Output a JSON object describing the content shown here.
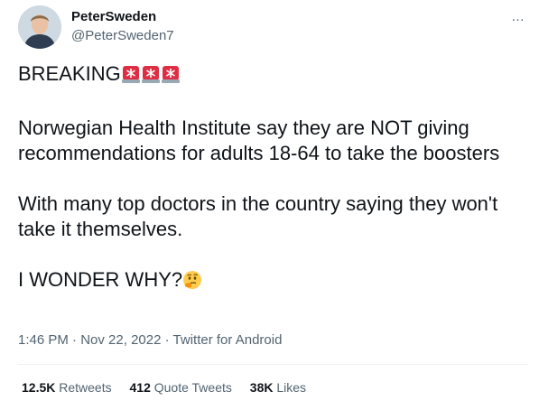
{
  "user": {
    "display_name": "PeterSweden",
    "handle": "@PeterSweden7"
  },
  "more_icon": "…",
  "tweet": {
    "line1_text": "BREAKING",
    "line1_emoji": [
      "police-light-icon",
      "police-light-icon",
      "police-light-icon"
    ],
    "paragraph2": "Norwegian Health Institute say they are NOT giving recommendations for adults 18-64 to take the boosters",
    "paragraph3": "With many top doctors in the country saying they won't take it themselves.",
    "paragraph4_text": "I WONDER WHY?",
    "paragraph4_emoji": "thinking-face-icon"
  },
  "meta": {
    "time": "1:46 PM",
    "separator": "·",
    "date": "Nov 22, 2022",
    "source": "Twitter for Android"
  },
  "stats": {
    "retweets_count": "12.5K",
    "retweets_label": "Retweets",
    "quotes_count": "412",
    "quotes_label": "Quote Tweets",
    "likes_count": "38K",
    "likes_label": "Likes"
  },
  "colors": {
    "text": "#0f1419",
    "secondary": "#536471",
    "siren_red": "#dd2e44"
  }
}
